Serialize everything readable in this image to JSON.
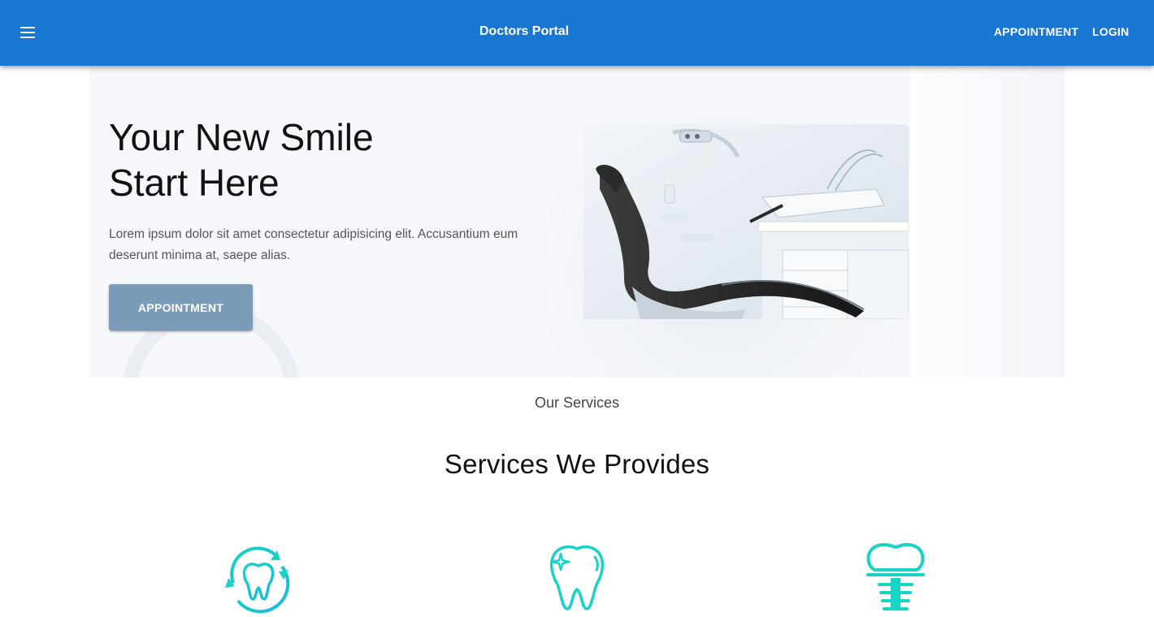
{
  "header": {
    "brand": "Doctors Portal",
    "nav": [
      {
        "label": "APPOINTMENT"
      },
      {
        "label": "LOGIN"
      }
    ],
    "menu_icon": "hamburger-menu-icon",
    "bar_color": "#1976d2"
  },
  "hero": {
    "title_line1": "Your New Smile",
    "title_line2": "Start Here",
    "text": "Lorem ipsum dolor sit amet consectetur adipisicing elit. Accusantium eum deserunt minima at, saepe alias.",
    "button_label": "APPOINTMENT",
    "button_color": "#7c9bb9",
    "image": "dental-chair-image"
  },
  "services": {
    "subtitle": "Our Services",
    "title": "Services We Provides",
    "items": [
      {
        "icon": "tooth-cleaning-icon"
      },
      {
        "icon": "tooth-whitening-icon"
      },
      {
        "icon": "dental-implant-icon"
      }
    ],
    "icon_color": "#19d3c5"
  }
}
